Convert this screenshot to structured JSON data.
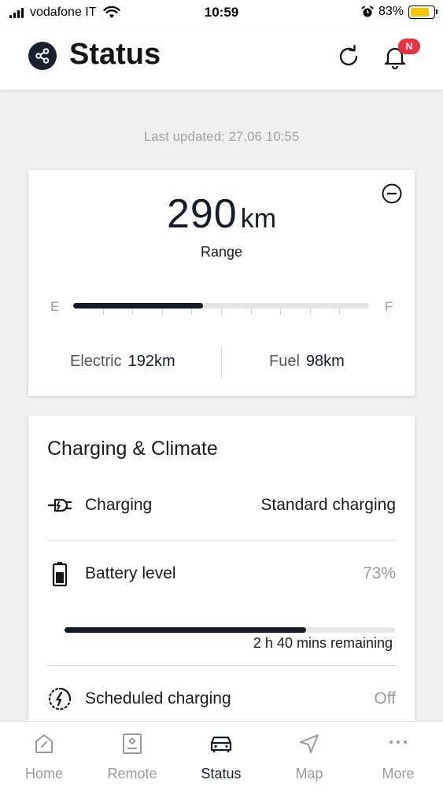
{
  "status_bar": {
    "carrier": "vodafone IT",
    "time": "10:59",
    "battery_percent": "83%",
    "battery_level": 0.83,
    "signal_bars": 4
  },
  "header": {
    "title": "Status",
    "notification_badge": "N"
  },
  "last_updated": "Last updated: 27.06 10:55",
  "range": {
    "value": "290",
    "unit": "km",
    "label": "Range",
    "gauge_empty_label": "E",
    "gauge_full_label": "F",
    "gauge_level": 0.44,
    "electric_label": "Electric",
    "electric_value": "192km",
    "fuel_label": "Fuel",
    "fuel_value": "98km"
  },
  "charging_climate": {
    "title": "Charging & Climate",
    "charging": {
      "label": "Charging",
      "value": "Standard charging"
    },
    "battery": {
      "label": "Battery level",
      "value": "73%",
      "level": 0.73,
      "remaining": "2 h 40 mins remaining"
    },
    "scheduled": {
      "label": "Scheduled charging",
      "value": "Off"
    }
  },
  "tabs": [
    {
      "label": "Home",
      "icon": "home-icon",
      "active": false
    },
    {
      "label": "Remote",
      "icon": "remote-icon",
      "active": false
    },
    {
      "label": "Status",
      "icon": "car-icon",
      "active": true
    },
    {
      "label": "Map",
      "icon": "navigation-arrow-icon",
      "active": false
    },
    {
      "label": "More",
      "icon": "more-dots-icon",
      "active": false
    }
  ],
  "colors": {
    "accent": "#141c2a",
    "badge": "#e53342",
    "battery_yellow": "#f7c600",
    "muted": "#9a9a9a"
  }
}
